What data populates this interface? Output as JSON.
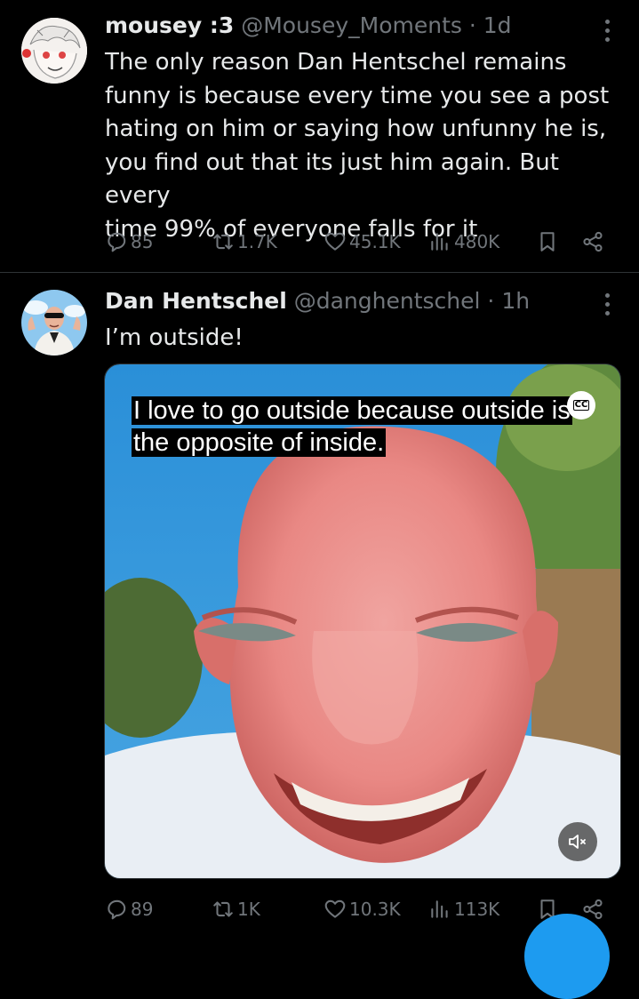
{
  "tweets": [
    {
      "display_name": "mousey :3",
      "handle": "@Mousey_Moments",
      "separator": "·",
      "time": "1d",
      "text_lines": [
        "The only reason Dan Hentschel remains",
        "funny is because every time you see a post",
        "hating on him or saying how unfunny he is,",
        "you find out that its just him again. But every",
        "time 99% of everyone falls for it"
      ],
      "replies": "85",
      "reposts": "1.7K",
      "likes": "45.1K",
      "views": "480K"
    },
    {
      "display_name": "Dan Hentschel",
      "handle": "@danghentschel",
      "separator": "·",
      "time": "1h",
      "text": "I’m outside!",
      "video": {
        "caption_lines": [
          "I love to go outside because outside is",
          "the opposite of inside."
        ],
        "cc_label": "CC"
      },
      "replies": "89",
      "reposts": "1K",
      "likes": "10.3K",
      "views": "113K"
    }
  ],
  "icons": {
    "reply": "reply-icon",
    "repost": "repost-icon",
    "like": "heart-icon",
    "views": "views-icon",
    "bookmark": "bookmark-icon",
    "share": "share-icon",
    "more": "more-vertical-icon",
    "mute": "muted-speaker-icon"
  },
  "colors": {
    "background": "#000000",
    "text": "#e7e9ea",
    "secondary": "#71767b",
    "divider": "#2f3336",
    "accent": "#1d9bf0"
  }
}
